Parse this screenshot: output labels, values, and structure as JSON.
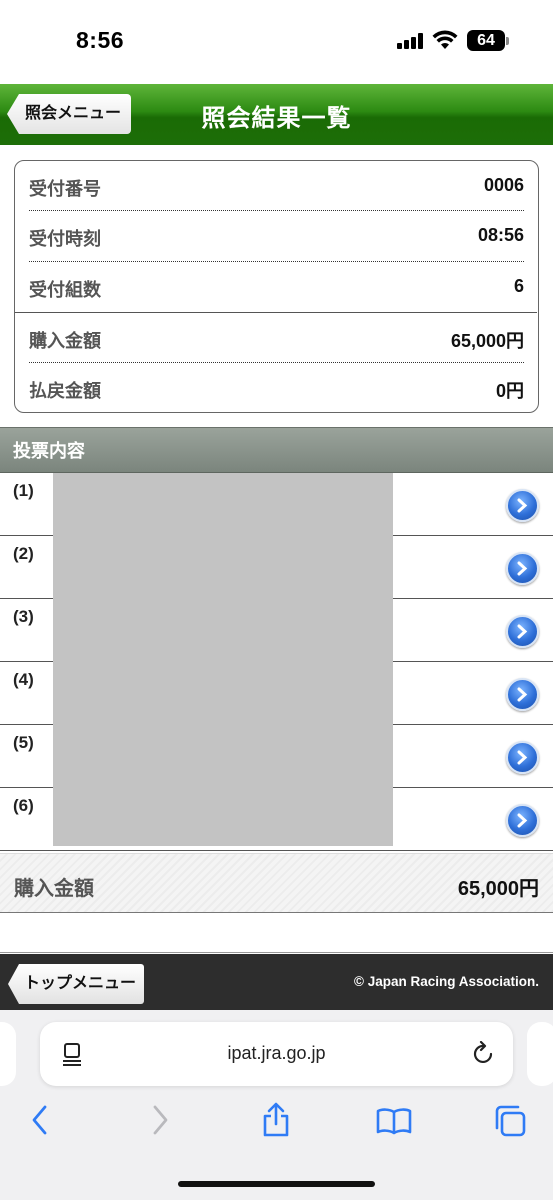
{
  "status_bar": {
    "time": "8:56",
    "battery": "64"
  },
  "header": {
    "back_label": "照会メニュー",
    "title": "照会結果一覧"
  },
  "info": {
    "rows": [
      {
        "label": "受付番号",
        "value": "0006"
      },
      {
        "label": "受付時刻",
        "value": "08:56"
      },
      {
        "label": "受付組数",
        "value": "6"
      },
      {
        "label": "購入金額",
        "value": "65,000円"
      },
      {
        "label": "払戻金額",
        "value": "0円"
      }
    ]
  },
  "section": {
    "title": "投票内容"
  },
  "bets": [
    {
      "number": "(1)"
    },
    {
      "number": "(2)"
    },
    {
      "number": "(3)"
    },
    {
      "number": "(4)"
    },
    {
      "number": "(5)"
    },
    {
      "number": "(6)"
    }
  ],
  "total": {
    "label": "購入金額",
    "value": "65,000円"
  },
  "footer": {
    "top_menu_label": "トップメニュー",
    "copyright": "© Japan Racing Association."
  },
  "browser": {
    "url": "ipat.jra.go.jp"
  },
  "colors": {
    "header_green": "#1d6e08",
    "section_gray": "#7b857d",
    "footer_dark": "#2d2d2d",
    "link_blue": "#2e6fd8",
    "redacted_gray": "#c3c3c3"
  }
}
